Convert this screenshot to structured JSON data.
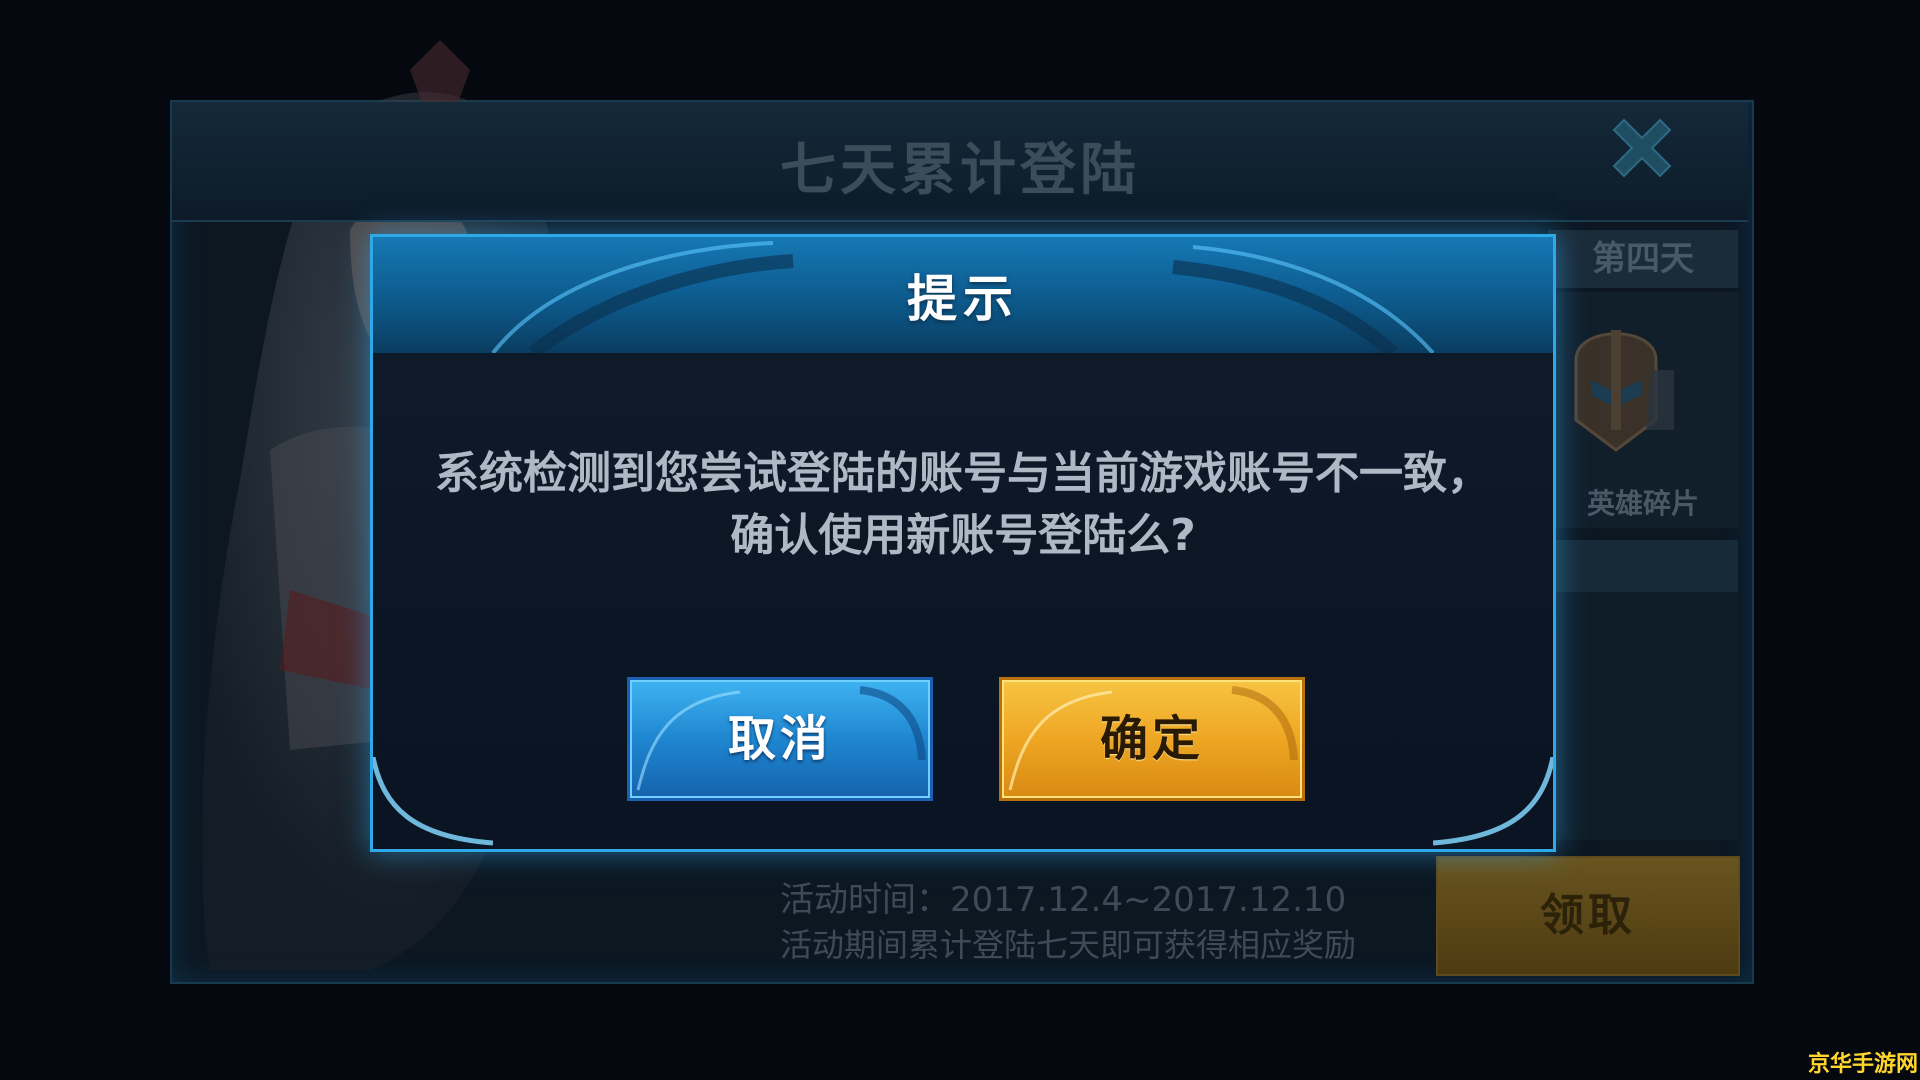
{
  "background": {
    "title": "七天累计登陆",
    "day_tab": "第四天",
    "reward_name": "英雄碎片",
    "event_time": "活动时间：2017.12.4~2017.12.10",
    "event_desc": "活动期间累计登陆七天即可获得相应奖励",
    "claim_label": "领取",
    "close_icon": "close-icon"
  },
  "dialog": {
    "title": "提示",
    "message_line1": "系统检测到您尝试登陆的账号与当前游戏账号不一致，",
    "message_line2": "确认使用新账号登陆么?",
    "cancel_label": "取消",
    "confirm_label": "确定"
  },
  "watermark": "京华手游网",
  "colors": {
    "dialog_border": "#2ea8e6",
    "cancel_button": "#1f86d0",
    "confirm_button": "#eea623",
    "watermark": "#ffd52e"
  }
}
